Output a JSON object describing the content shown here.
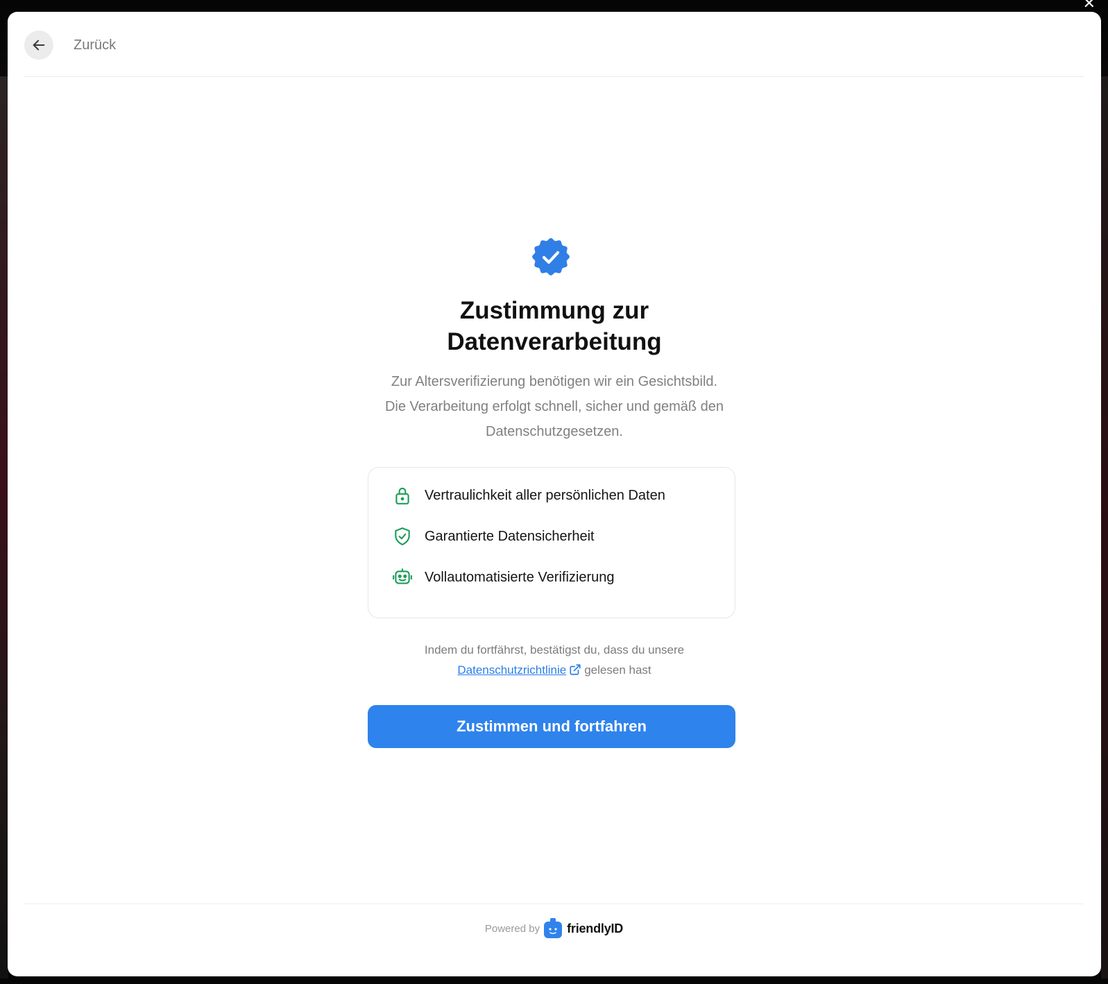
{
  "header": {
    "back_label": "Zurück"
  },
  "main": {
    "title_line1": "Zustimmung zur",
    "title_line2": "Datenverarbeitung",
    "description_line1": "Zur Altersverifizierung benötigen wir ein Gesichtsbild.",
    "description_line2": "Die Verarbeitung erfolgt schnell, sicher und gemäß den",
    "description_line3": "Datenschutzgesetzen.",
    "features": [
      {
        "icon": "lock-icon",
        "label": "Vertraulichkeit aller persönlichen Daten"
      },
      {
        "icon": "shield-check-icon",
        "label": "Garantierte Datensicherheit"
      },
      {
        "icon": "robot-icon",
        "label": "Vollautomatisierte Verifizierung"
      }
    ],
    "consent_text_before": "Indem du fortfährst, bestätigst du, dass du unsere",
    "consent_link": "Datenschutzrichtlinie",
    "consent_text_after": "gelesen hast",
    "cta_label": "Zustimmen und fortfahren"
  },
  "footer": {
    "powered_by": "Powered by",
    "brand": "friendlyID"
  },
  "colors": {
    "accent": "#2f83ec",
    "feature_icon": "#1e9e5a",
    "link": "#2b7de9"
  }
}
